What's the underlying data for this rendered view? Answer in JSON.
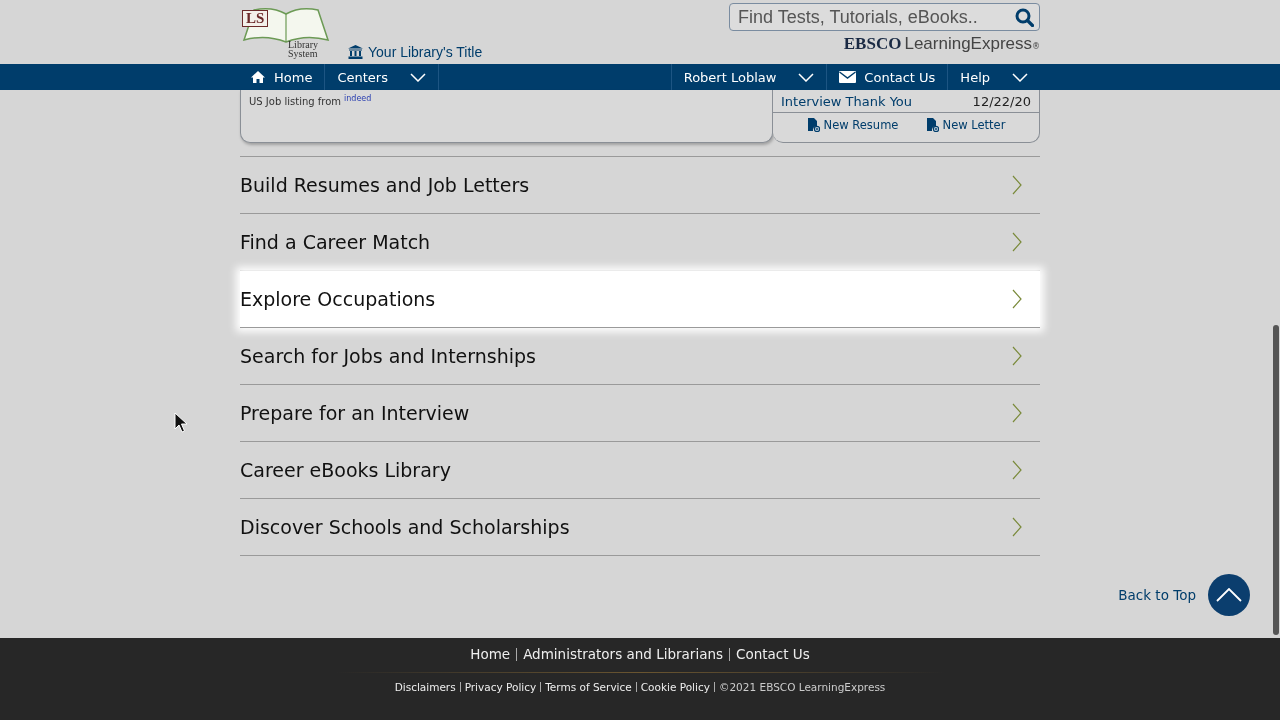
{
  "header": {
    "logo": {
      "initials": "LS",
      "line_1": "Library",
      "line_2": "System"
    },
    "library_title": "Your Library's Title",
    "search": {
      "placeholder": "Find Tests, Tutorials, eBooks.."
    },
    "brand": {
      "name_1": "EBSCO",
      "name_2": "LearningExpress",
      "mark": "®"
    }
  },
  "nav": {
    "left": [
      {
        "label": "Home",
        "kind": "home",
        "dropdown": false
      },
      {
        "label": "Centers",
        "kind": "plain",
        "dropdown": true
      }
    ],
    "right": [
      {
        "label": "Robert Loblaw",
        "kind": "plain",
        "dropdown": true
      },
      {
        "label": "Contact Us",
        "kind": "mail",
        "dropdown": false
      },
      {
        "label": "Help",
        "kind": "plain",
        "dropdown": true
      }
    ]
  },
  "jobs_card": {
    "source_text": "US Job listing from",
    "source_logo": "indeed"
  },
  "documents_card": {
    "recent": {
      "title": "Interview Thank You",
      "date": "12/22/20"
    },
    "actions": [
      "New Resume",
      "New Letter"
    ]
  },
  "sections": [
    {
      "label": "Build Resumes and Job Letters",
      "highlighted": false
    },
    {
      "label": "Find a Career Match",
      "highlighted": false
    },
    {
      "label": "Explore Occupations",
      "highlighted": true
    },
    {
      "label": "Search for Jobs and Internships",
      "highlighted": false
    },
    {
      "label": "Prepare for an Interview",
      "highlighted": false
    },
    {
      "label": "Career eBooks Library",
      "highlighted": false
    },
    {
      "label": "Discover Schools and Scholarships",
      "highlighted": false
    }
  ],
  "back_to_top": "Back to Top",
  "footer": {
    "links": [
      "Home",
      "Administrators and Librarians",
      "Contact Us"
    ],
    "legal_links": [
      "Disclaimers",
      "Privacy Policy",
      "Terms of Service",
      "Cookie Policy"
    ],
    "copyright": "©2021 EBSCO LearningExpress"
  }
}
